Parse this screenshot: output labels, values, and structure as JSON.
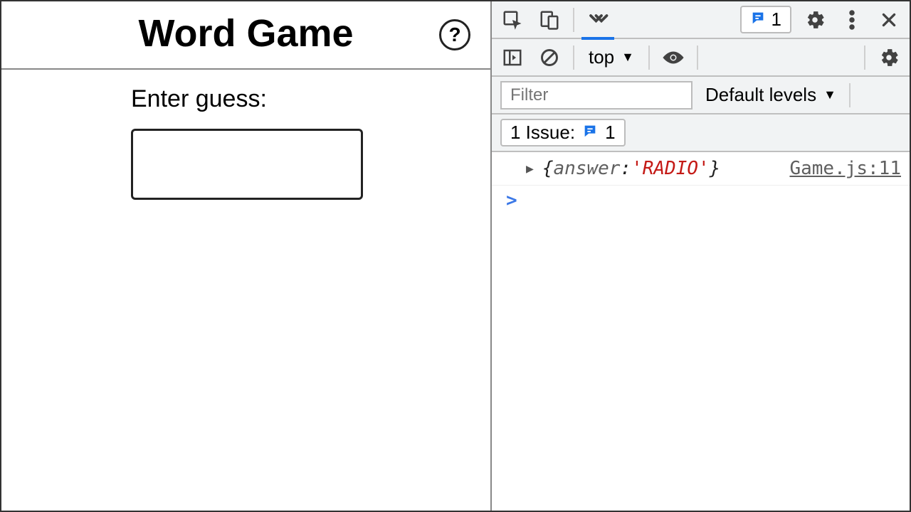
{
  "app": {
    "title": "Word Game",
    "help_glyph": "?",
    "guess_label": "Enter guess:",
    "guess_value": ""
  },
  "devtools": {
    "issues_badge_count": "1",
    "context_label": "top",
    "filter_placeholder": "Filter",
    "levels_label": "Default levels",
    "issue_bar_label": "1 Issue:",
    "issue_bar_count": "1",
    "log": {
      "brace_open": "{",
      "key": "answer",
      "colon": ": ",
      "value": "'RADIO'",
      "brace_close": "}",
      "source": "Game.js:11"
    },
    "prompt_caret": ">"
  }
}
